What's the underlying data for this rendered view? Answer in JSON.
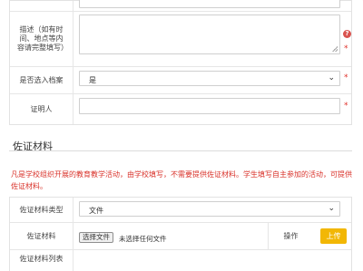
{
  "form": {
    "description": {
      "label": "描述（如有时间、地点等内容请完整填写）",
      "value": ""
    },
    "archive": {
      "label": "是否选入档案",
      "value": "是"
    },
    "witness": {
      "label": "证明人",
      "value": ""
    },
    "required_mark": "*",
    "help_mark": "?"
  },
  "evidence": {
    "section_title": "佐证材料",
    "notice": "凡是学校组织开展的教育教学活动，由学校填写，不需要提供佐证材料。学生填写自主参加的活动，可提供佐证材料。",
    "type": {
      "label": "佐证材料类型",
      "value": "文件"
    },
    "file": {
      "label": "佐证材料",
      "button": "选择文件",
      "status": "未选择任何文件",
      "op_label": "操作",
      "upload": "上传"
    },
    "list": {
      "label": "佐证材料列表"
    }
  },
  "colors": {
    "required": "#e0312b",
    "upload_button": "#f2b705",
    "notice": "#d9322a"
  }
}
